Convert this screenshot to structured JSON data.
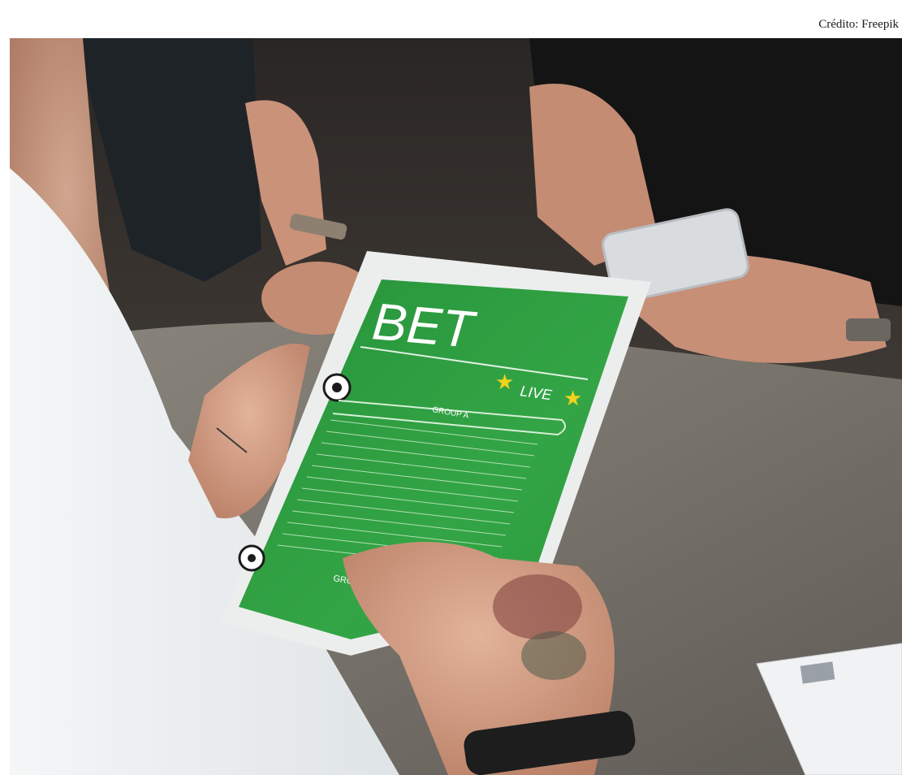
{
  "credit": "Crédito: Freepik",
  "tablet": {
    "title": "BET",
    "live_label": "LIVE",
    "group_a_label": "GROUP A",
    "group_b_label": "GRO"
  },
  "colors": {
    "tablet_green": "#2f9a3a",
    "tablet_frame": "#ecefec",
    "table_surface": "#6f6b64",
    "star_yellow": "#f2d21a"
  }
}
